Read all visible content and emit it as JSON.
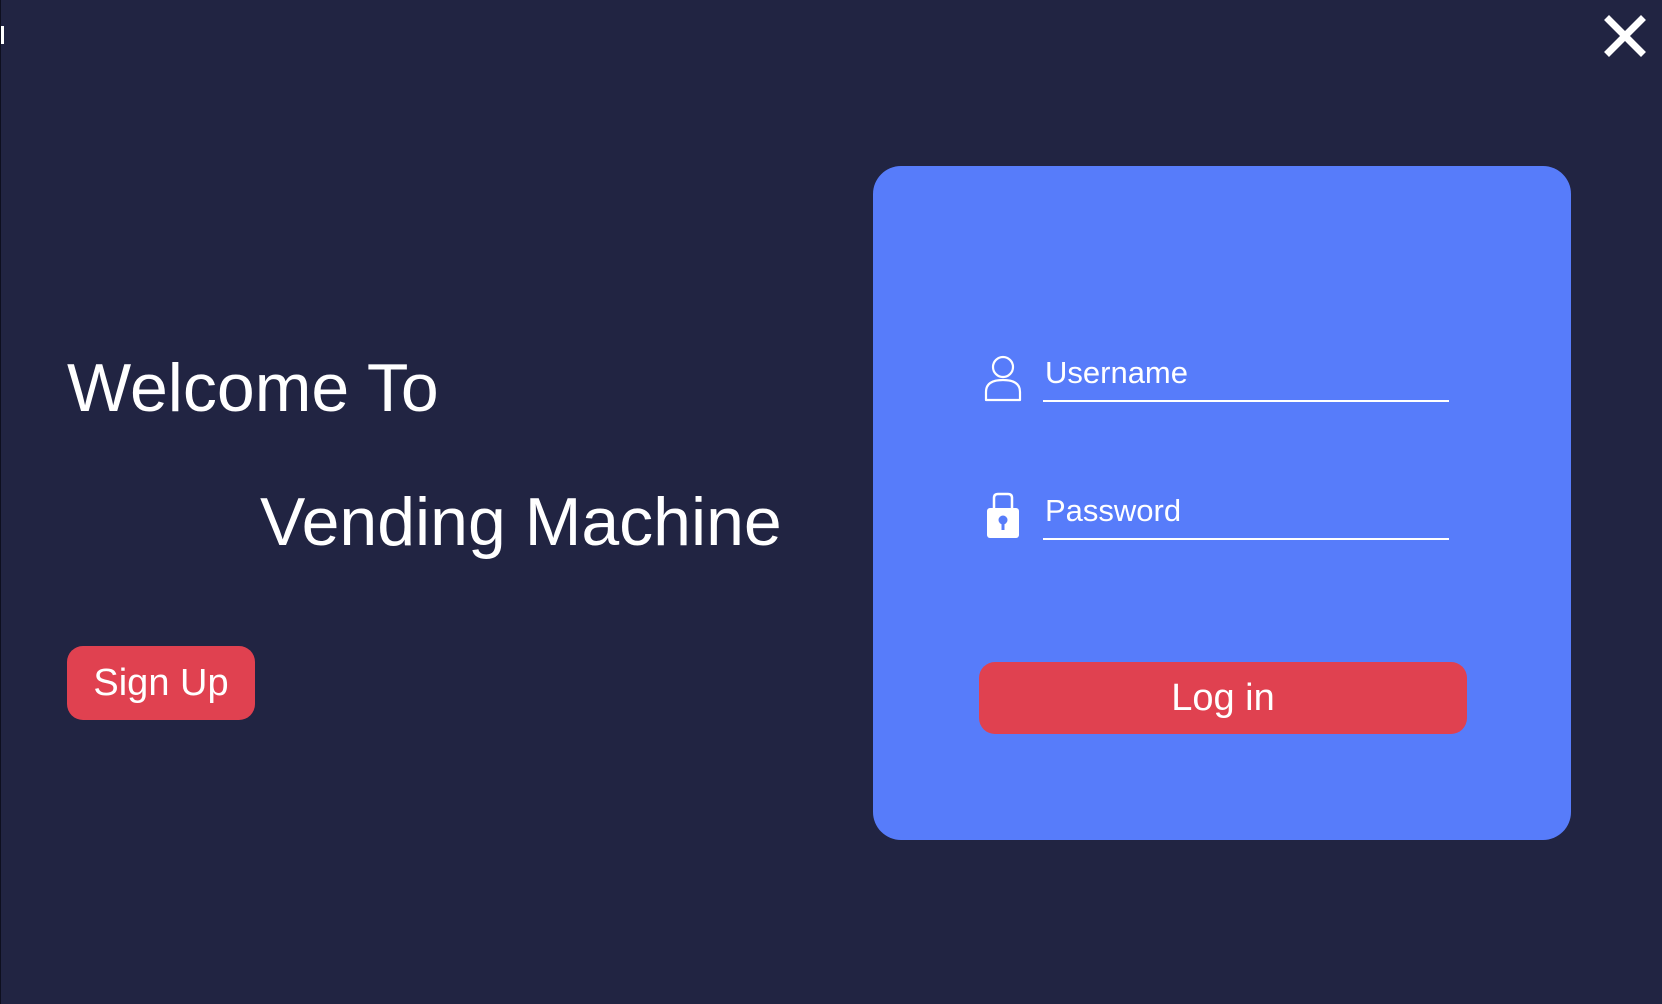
{
  "window": {
    "close_icon": "close-icon",
    "colors": {
      "background": "#212442",
      "card": "#577cfa",
      "button": "#e04150",
      "text": "#ffffff"
    }
  },
  "welcome": {
    "line1": "Welcome To",
    "line2": "Vending Machine"
  },
  "signup": {
    "label": "Sign Up"
  },
  "login_form": {
    "username": {
      "icon": "user-icon",
      "placeholder": "Username",
      "value": ""
    },
    "password": {
      "icon": "lock-icon",
      "placeholder": "Password",
      "value": ""
    },
    "login_label": "Log in"
  }
}
